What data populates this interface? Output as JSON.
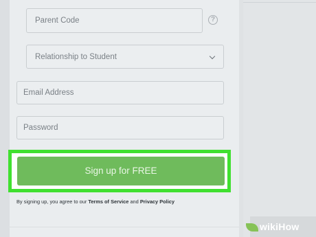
{
  "form": {
    "parent_code_placeholder": "Parent Code",
    "help_icon_glyph": "?",
    "relationship_placeholder": "Relationship to Student",
    "email_placeholder": "Email Address",
    "password_placeholder": "Password",
    "signup_label": "Sign up for FREE"
  },
  "legal": {
    "prefix": "By signing up, you agree to our ",
    "terms_link": "Terms of Service",
    "and": " and ",
    "privacy_link": "Privacy Policy"
  },
  "watermark": {
    "wiki": "wiki",
    "how": "How"
  },
  "colors": {
    "accent_green": "#6fbb5c",
    "highlight_green": "#40e030"
  }
}
